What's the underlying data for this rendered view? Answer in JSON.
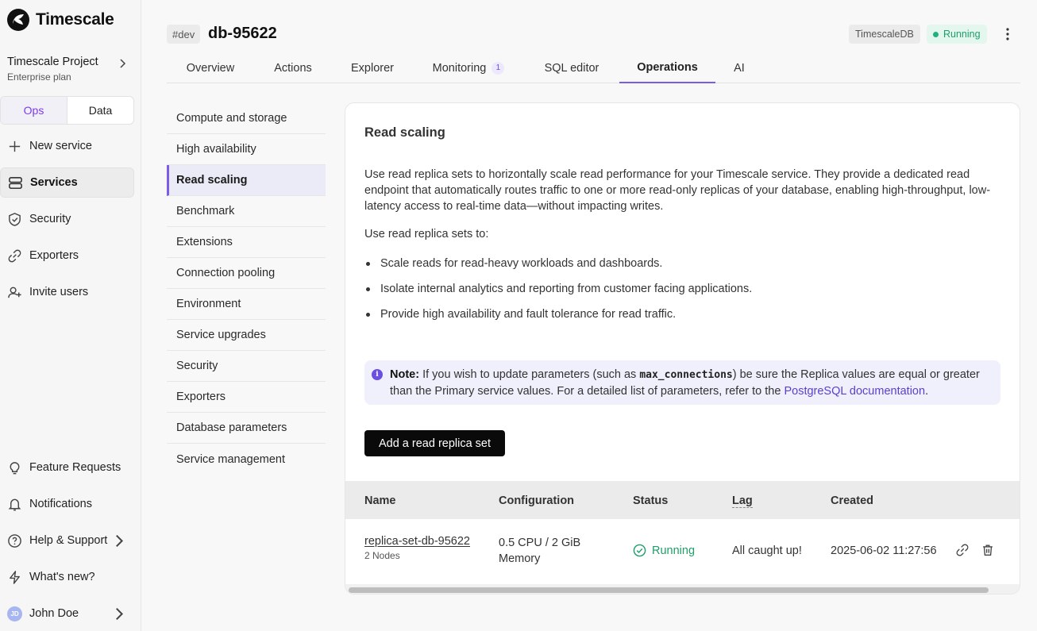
{
  "app": {
    "brand": "Timescale"
  },
  "project": {
    "name": "Timescale Project",
    "plan": "Enterprise plan"
  },
  "mode_toggle": {
    "options": [
      "Ops",
      "Data"
    ],
    "selected": "Ops"
  },
  "sidebar": {
    "top_items": [
      {
        "label": "New service",
        "icon": "plus-icon"
      },
      {
        "label": "Services",
        "icon": "server-icon",
        "active": true
      },
      {
        "label": "Security",
        "icon": "shield-check-icon"
      },
      {
        "label": "Exporters",
        "icon": "link-icon"
      },
      {
        "label": "Invite users",
        "icon": "user-plus-icon"
      }
    ],
    "bottom_items": [
      {
        "label": "Feature Requests",
        "icon": "lightbulb-icon"
      },
      {
        "label": "Notifications",
        "icon": "bell-icon"
      },
      {
        "label": "Help & Support",
        "icon": "help-circle-icon"
      },
      {
        "label": "What's new?",
        "icon": "zap-icon"
      }
    ],
    "user": {
      "name": "John Doe",
      "initials": "JD"
    }
  },
  "header": {
    "env": "#dev",
    "service_name": "db-95622",
    "type_badge": "TimescaleDB",
    "status": "Running",
    "tabs": [
      {
        "label": "Overview"
      },
      {
        "label": "Actions"
      },
      {
        "label": "Explorer"
      },
      {
        "label": "Monitoring",
        "count": "1"
      },
      {
        "label": "SQL editor"
      },
      {
        "label": "Operations",
        "active": true
      },
      {
        "label": "AI"
      }
    ]
  },
  "subnav": {
    "items": [
      "Compute and storage",
      "High availability",
      "Read scaling",
      "Benchmark",
      "Extensions",
      "Connection pooling",
      "Environment",
      "Service upgrades",
      "Security",
      "Exporters",
      "Database parameters",
      "Service management"
    ],
    "active": "Read scaling"
  },
  "card": {
    "title": "Read scaling",
    "description": "Use read replica sets to horizontally scale read performance for your Timescale service. They provide a dedicated read endpoint that automatically routes traffic to one or more read-only replicas of your database, enabling high-throughput, low-latency access to real-time data—without impacting writes.",
    "intro": "Use read replica sets to:",
    "bullets": [
      "Scale reads for read-heavy workloads and dashboards.",
      "Isolate internal analytics and reporting from customer facing applications.",
      "Provide high availability and fault tolerance for read traffic."
    ],
    "note": {
      "label": "Note:",
      "text_before": "If you wish to update parameters (such as",
      "code": "max_connections",
      "text_after": ") be sure the Replica values are equal or greater than the Primary service values. For a detailed list of parameters, refer to the",
      "link": "PostgreSQL documentation",
      "end": "."
    },
    "add_button": "Add a read replica set"
  },
  "table": {
    "headers": [
      "Name",
      "Configuration",
      "Status",
      "Lag",
      "Created"
    ],
    "rows": [
      {
        "name": "replica-set-db-95622",
        "nodes": "2 Nodes",
        "config_line1": "0.5 CPU / 2 GiB",
        "config_line2": "Memory",
        "status": "Running",
        "lag": "All caught up!",
        "created": "2025-06-02 11:27:56"
      }
    ]
  },
  "colors": {
    "accent": "#7c5ce6",
    "success": "#1f9d6a",
    "primary_button": "#0a0a0a"
  }
}
